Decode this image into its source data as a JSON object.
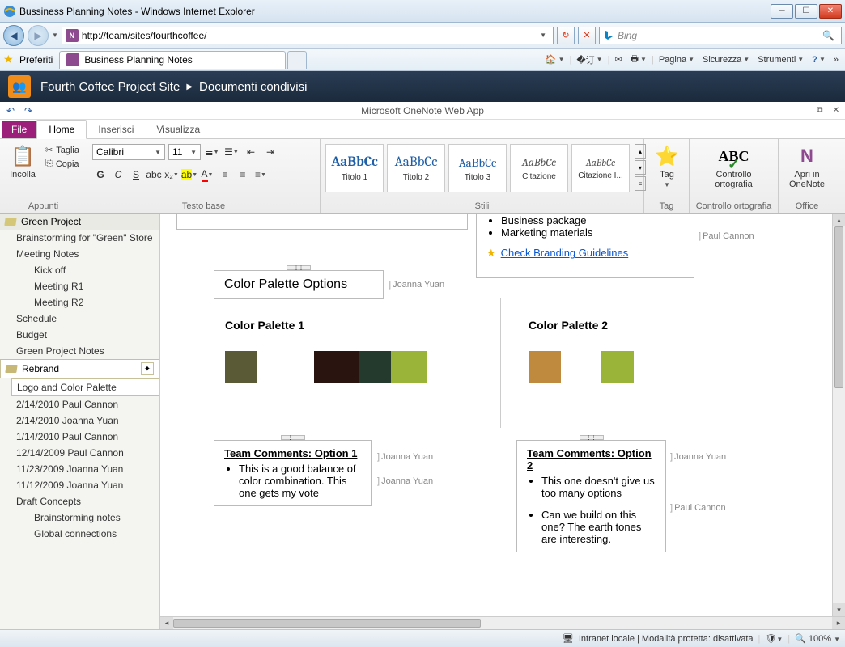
{
  "window": {
    "title": "Bussiness Planning Notes - Windows Internet Explorer"
  },
  "nav": {
    "url": "http://team/sites/fourthcoffee/",
    "search_placeholder": "Bing"
  },
  "favbar": {
    "label": "Preferiti",
    "tab_title": "Business Planning Notes"
  },
  "cmdbar": {
    "pagina": "Pagina",
    "sicurezza": "Sicurezza",
    "strumenti": "Strumenti"
  },
  "sp": {
    "site": "Fourth Coffee Project Site",
    "lib": "Documenti condivisi"
  },
  "app": {
    "title": "Microsoft OneNote Web App"
  },
  "ribbon_tabs": {
    "file": "File",
    "home": "Home",
    "inserisci": "Inserisci",
    "visualizza": "Visualizza"
  },
  "ribbon": {
    "incolla": "Incolla",
    "taglia": "Taglia",
    "copia": "Copia",
    "appunti": "Appunti",
    "font_name": "Calibri",
    "font_size": "11",
    "testo_base": "Testo base",
    "stili": "Stili",
    "styles": {
      "t1": "Titolo 1",
      "t2": "Titolo 2",
      "t3": "Titolo 3",
      "cit": "Citazione",
      "citi": "Citazione I..."
    },
    "tag": "Tag",
    "tag_group": "Tag",
    "ortografia": "Controllo ortografia",
    "ortografia_group": "Controllo ortografia",
    "onenote": "Apri in OneNote",
    "office_group": "Office"
  },
  "sidebar": {
    "sections": {
      "green": "Green Project",
      "rebrand": "Rebrand"
    },
    "green_pages": {
      "brainstorm": "Brainstorming for \"Green\" Store",
      "meeting": "Meeting Notes",
      "kickoff": "Kick off",
      "r1": "Meeting R1",
      "r2": "Meeting R2",
      "schedule": "Schedule",
      "budget": "Budget",
      "notes": "Green Project Notes"
    },
    "rebrand_pages": {
      "logo": "Logo and Color Palette",
      "h1": "2/14/2010 Paul Cannon",
      "h2": "2/14/2010 Joanna Yuan",
      "h3": "1/14/2010 Paul Cannon",
      "h4": "12/14/2009 Paul Cannon",
      "h5": "11/23/2009 Joanna Yuan",
      "h6": "11/12/2009 Joanna Yuan",
      "draft": "Draft Concepts",
      "d1": "Brainstorming notes",
      "d2": "Global connections"
    }
  },
  "canvas": {
    "top_list": {
      "i1": "Business package",
      "i2": "Marketing materials"
    },
    "check_link": "Check Branding Guidelines",
    "title_box": "Color Palette Options",
    "p1": "Color Palette 1",
    "p2": "Color Palette 2",
    "palette1_colors": [
      "#5a5a36",
      "#2a1410",
      "#243a2c",
      "#9ab43a"
    ],
    "palette2_colors": [
      "#c08a3e",
      "#9ab43a"
    ],
    "c1_title": "Team Comments: Option 1",
    "c1_b1": "This is a good balance of color combination. This one gets my vote",
    "c2_title": "Team Comments: Option 2",
    "c2_b1": "This one doesn't give us too many options",
    "c2_b2": "Can we build on this one? The earth tones are interesting.",
    "authors": {
      "pc": "Paul Cannon",
      "jy": "Joanna Yuan"
    }
  },
  "status": {
    "zone": "Intranet locale | Modalità protetta: disattivata",
    "zoom": "100%"
  }
}
